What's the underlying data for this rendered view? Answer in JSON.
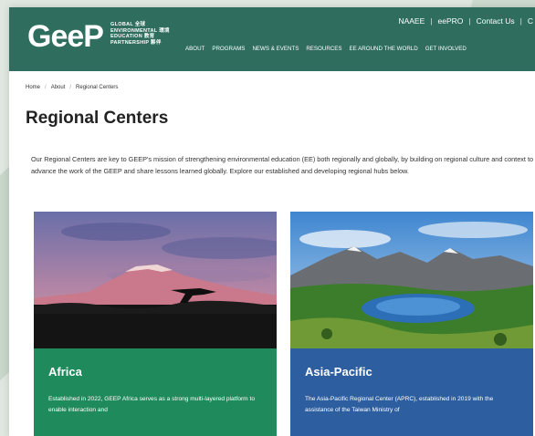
{
  "logo": {
    "word": "GeeP",
    "subtitle": "GLOBAL 全球\nENVIRONMENTAL 環境\nEDUCATION 教育\nPARTNERSHIP 夥伴"
  },
  "utility_nav": [
    "NAAEE",
    "eePRO",
    "Contact Us",
    "C"
  ],
  "main_nav": [
    "ABOUT",
    "PROGRAMS",
    "NEWS & EVENTS",
    "RESOURCES",
    "EE AROUND THE WORLD",
    "GET INVOLVED"
  ],
  "breadcrumb": [
    "Home",
    "About",
    "Regional Centers"
  ],
  "page_title": "Regional Centers",
  "intro": "Our Regional Centers are key to GEEP's mission of strengthening environmental education (EE) both regionally and globally, by building on regional culture and context to advance the work of the GEEP and share lessons learned globally. Explore our established and developing regional hubs below.",
  "cards": [
    {
      "title": "Africa",
      "text": "Established in 2022, GEEP Africa serves as a strong multi-layered platform to enable interaction and",
      "color": "#1f8a5b"
    },
    {
      "title": "Asia-Pacific",
      "text": "The Asia-Pacific Regional Center (APRC), established in 2019 with the assistance of the Taiwan Ministry of",
      "color": "#2d5fa0"
    }
  ],
  "colors": {
    "header": "#2f6d5e",
    "background": "#dfe7e0"
  }
}
